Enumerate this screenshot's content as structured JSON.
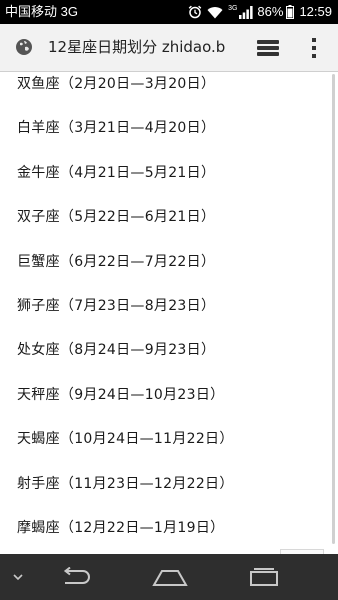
{
  "status_bar": {
    "carrier": "中国移动 3G",
    "network_small": "3G",
    "battery_percent": "86%",
    "time": "12:59",
    "icons": [
      "alarm-icon",
      "wifi-icon",
      "signal-icon",
      "battery-icon"
    ]
  },
  "toolbar": {
    "url_title": "12星座日期划分  zhidao.b",
    "icons": [
      "globe-icon",
      "tabs-icon",
      "overflow-menu-icon"
    ]
  },
  "zodiac_list": [
    "双鱼座（2月20日—3月20日）",
    "白羊座（3月21日—4月20日）",
    "金牛座（4月21日—5月21日）",
    "双子座（5月22日—6月21日）",
    "巨蟹座（6月22日—7月22日）",
    "狮子座（7月23日—8月23日）",
    "处女座（8月24日—9月23日）",
    "天秤座（9月24日—10月23日）",
    "天蝎座（10月24日—11月22日）",
    "射手座（11月23日—12月22日）",
    "摩蝎座（12月22日—1月19日）"
  ],
  "navbar": {
    "icons": [
      "hide-keyboard-icon",
      "back-icon",
      "home-icon",
      "recent-apps-icon"
    ]
  },
  "colors": {
    "status_bar_bg": "#000000",
    "toolbar_bg": "#f2f2f2",
    "content_bg": "#ffffff",
    "navbar_bg": "#2e2e2e"
  }
}
